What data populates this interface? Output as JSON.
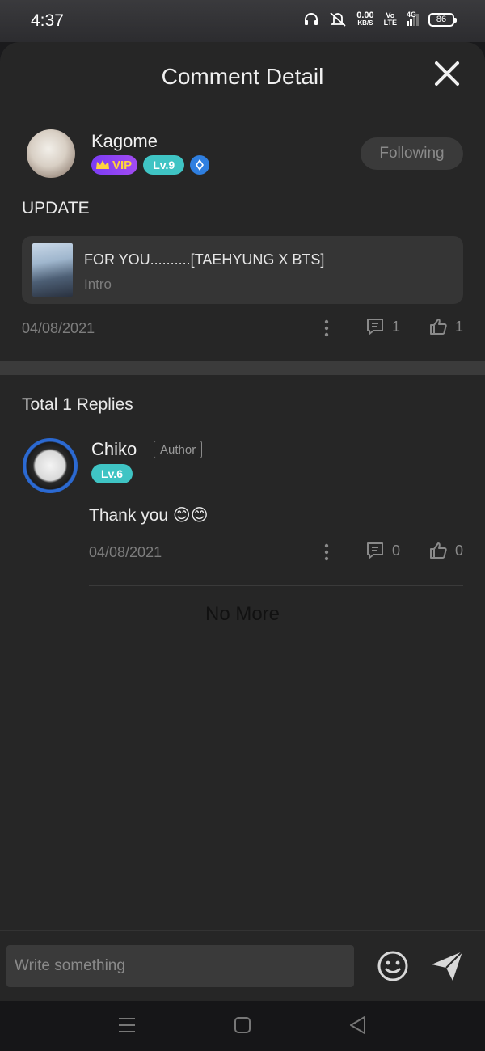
{
  "status_bar": {
    "time": "4:37",
    "net_speed_value": "0.00",
    "net_speed_unit": "KB/S",
    "volte_top": "Vo",
    "volte_bottom": "LTE",
    "network": "4G",
    "battery": "86"
  },
  "header": {
    "title": "Comment Detail"
  },
  "comment": {
    "username": "Kagome",
    "vip_label": "VIP",
    "level": "Lv.9",
    "follow_label": "Following",
    "text": "UPDATE",
    "book": {
      "title": "FOR YOU..........[TAEHYUNG X BTS]",
      "subtitle": "Intro"
    },
    "date": "04/08/2021",
    "reply_count": "1",
    "like_count": "1"
  },
  "replies": {
    "title": "Total 1 Replies",
    "items": [
      {
        "username": "Chiko",
        "author_tag": "Author",
        "level": "Lv.6",
        "text": "Thank you 😊😊",
        "date": "04/08/2021",
        "reply_count": "0",
        "like_count": "0"
      }
    ],
    "end_text": "No More"
  },
  "input": {
    "placeholder": "Write something"
  },
  "colors": {
    "sheet_bg": "#262626",
    "level_badge": "#3fc4c4",
    "vip_badge": "#7b3cf4"
  }
}
